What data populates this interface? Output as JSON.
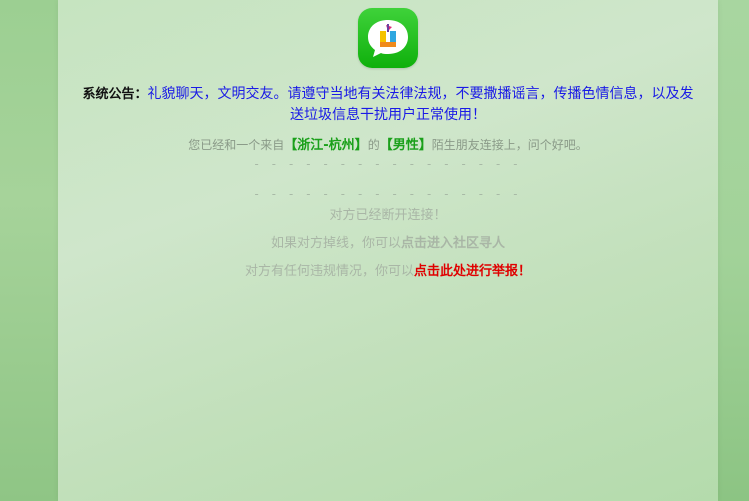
{
  "notice": {
    "label": "系统公告：",
    "text": "礼貌聊天，文明交友。请遵守当地有关法律法规，不要撒播谣言，传播色情信息，以及发送垃圾信息干扰用户正常使用！"
  },
  "status": {
    "prefix": "您已经和一个来自",
    "location": "【浙江-杭州】",
    "middle": "的",
    "gender": "【男性】",
    "suffix": "陌生朋友连接上，问个好吧。"
  },
  "dash_line": "- - - - - - - - - - - - - - - - - - - - - - - - - - - - - -",
  "system_messages": {
    "disconnected": "对方已经断开连接！",
    "dropped_prefix": "如果对方掉线，你可以",
    "dropped_link": "点击进入社区寻人",
    "report_prefix": "对方有任何违规情况，你可以",
    "report_link": "点击此处进行举报！"
  },
  "colors": {
    "notice_text": "#1a1ae6",
    "highlight_green": "#1aa01a",
    "report_red": "#e00000",
    "logo_green": "#0fb00c"
  },
  "icons": {
    "logo": "chat-bubble-app-icon"
  }
}
